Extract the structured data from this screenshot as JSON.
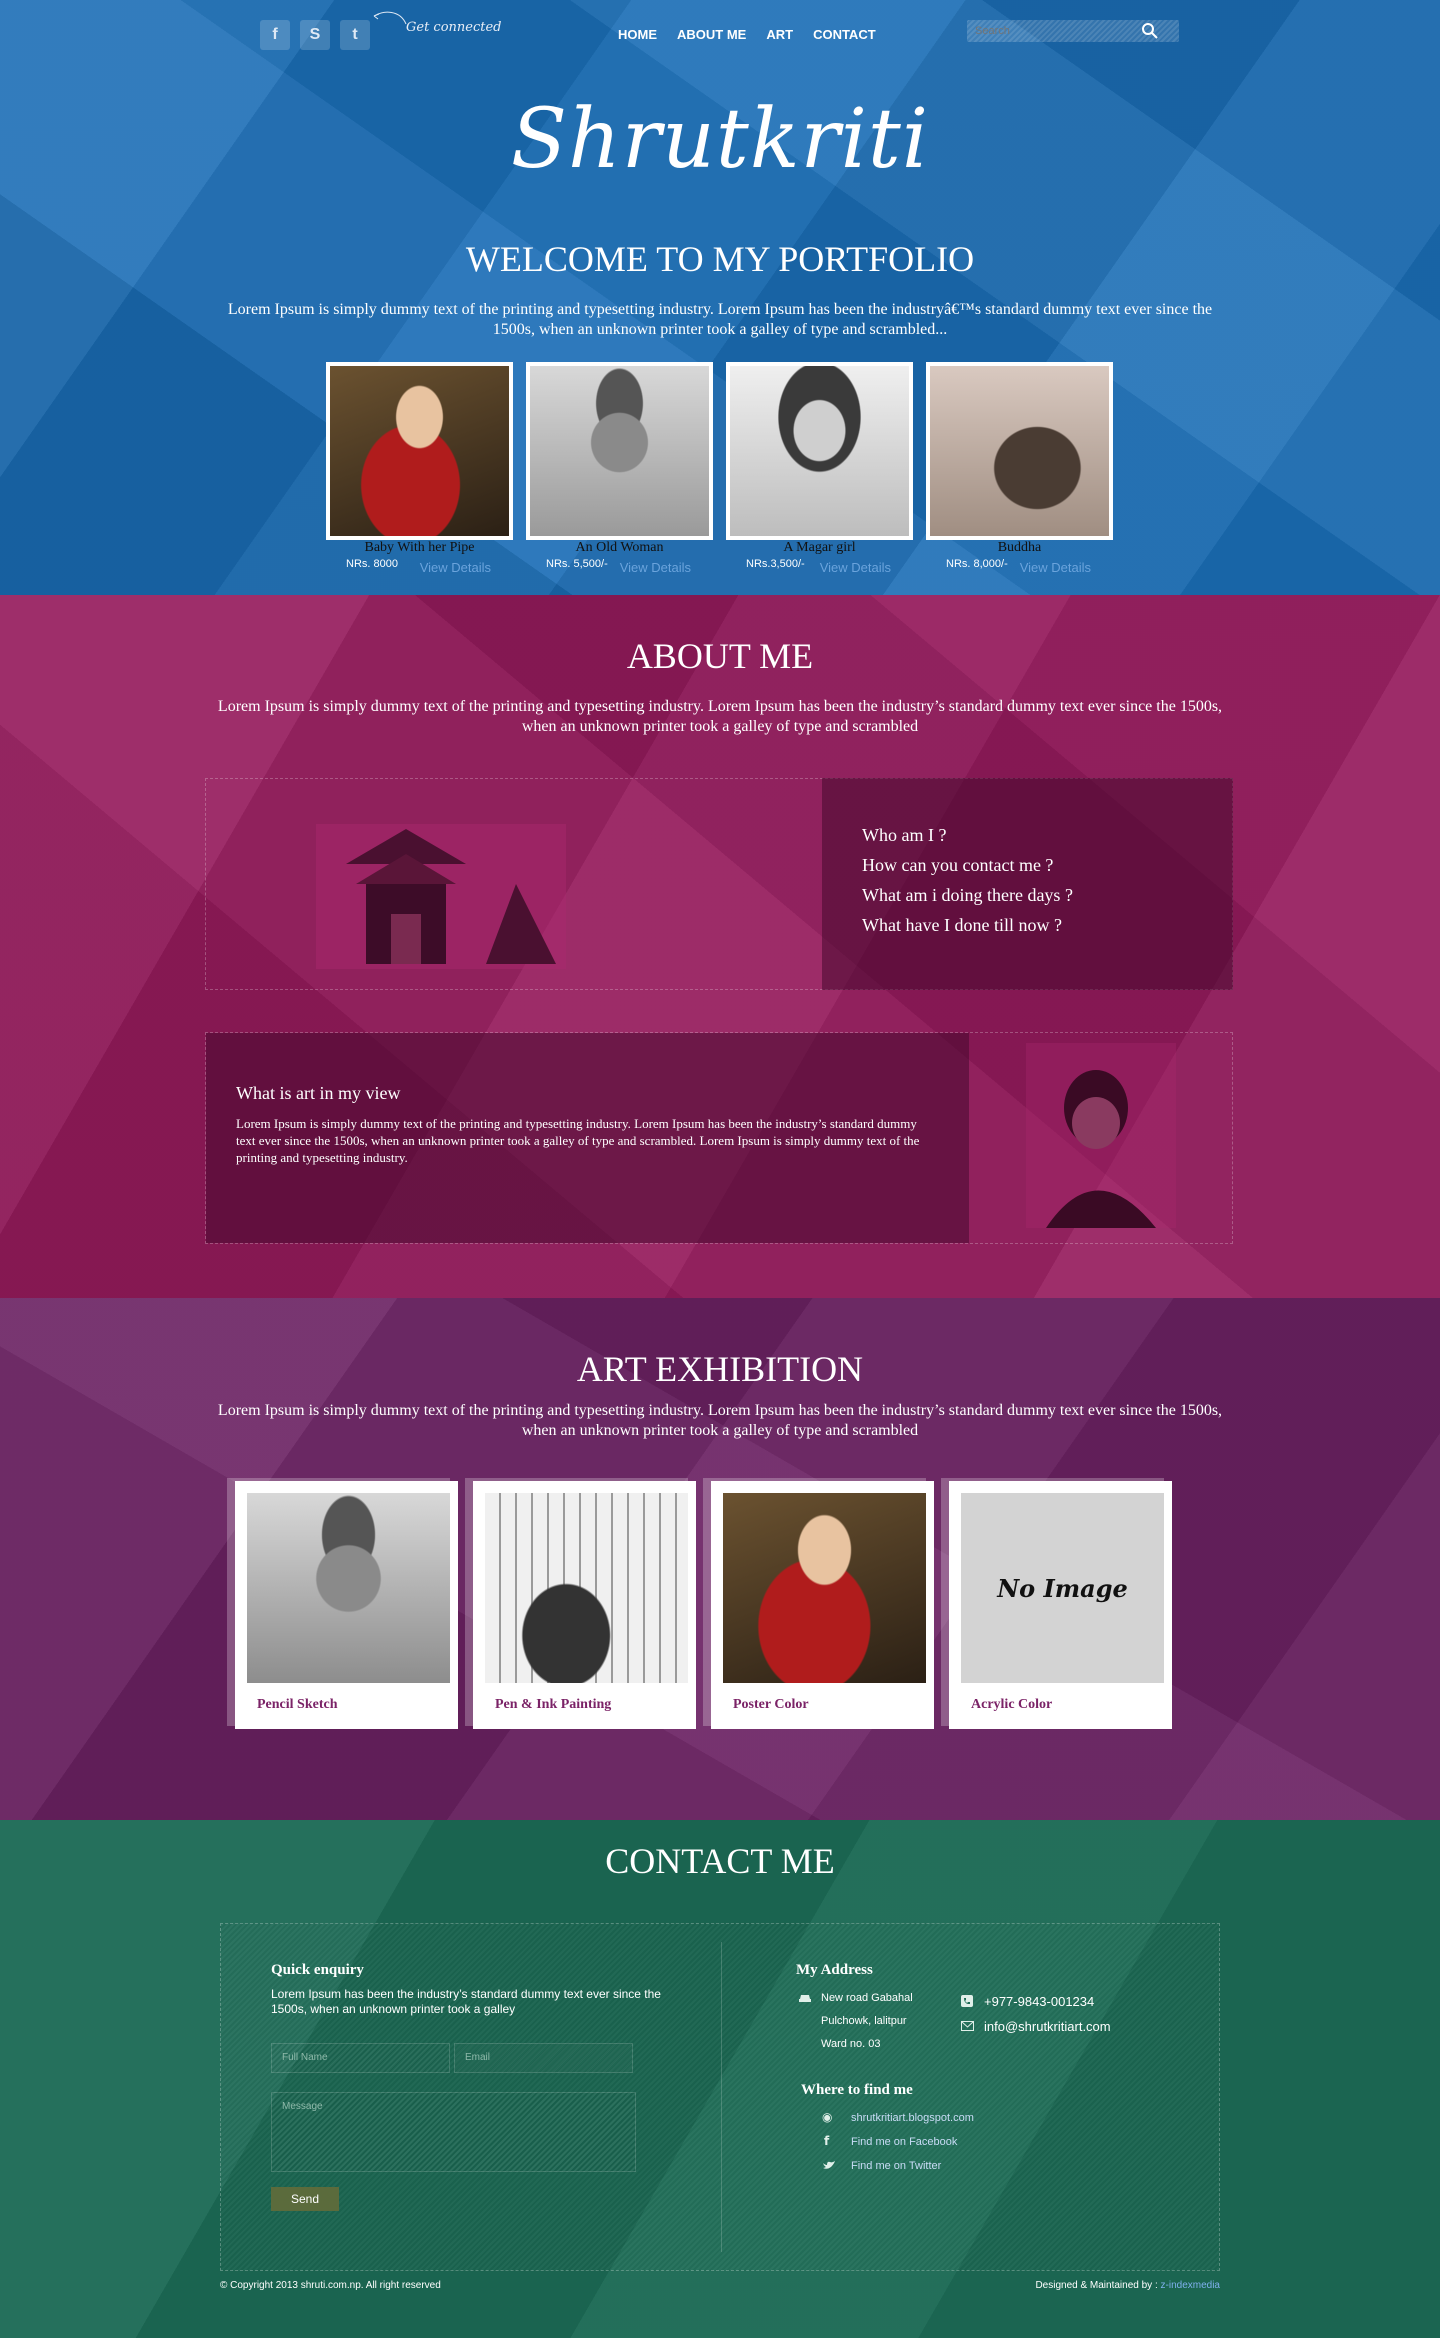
{
  "header": {
    "social": [
      {
        "name": "facebook-icon",
        "glyph": "f"
      },
      {
        "name": "skype-icon",
        "glyph": "S"
      },
      {
        "name": "twitter-icon",
        "glyph": "t"
      }
    ],
    "get_connected": "Get connected",
    "nav": [
      "HOME",
      "ABOUT ME",
      "ART",
      "CONTACT"
    ],
    "search_placeholder": "Search"
  },
  "hero": {
    "logo": "Shrutkriti",
    "welcome": "WELCOME TO MY PORTFOLIO",
    "intro": "Lorem Ipsum is simply dummy text of the printing and typesetting industry. Lorem Ipsum has been the industryâ€™s standard dummy text ever since the 1500s, when an unknown printer took a galley of type and scrambled...",
    "items": [
      {
        "title": "Baby With her Pipe",
        "price": "NRs. 8000",
        "details": "View Details"
      },
      {
        "title": "An Old Woman",
        "price": "NRs. 5,500/-",
        "details": "View Details"
      },
      {
        "title": "A Magar girl",
        "price": "NRs.3,500/-",
        "details": "View Details"
      },
      {
        "title": "Buddha",
        "price": "NRs. 8,000/-",
        "details": "View Details"
      }
    ]
  },
  "about": {
    "title": "ABOUT ME",
    "intro": "Lorem Ipsum is simply dummy text of the printing and typesetting industry. Lorem Ipsum has been the industry’s standard dummy text ever since the 1500s, when an unknown printer took a galley of type and scrambled",
    "questions": [
      "Who am I ?",
      "How can you contact me ?",
      "What am i doing there days ?",
      "What have I done till now ?"
    ],
    "art_view_title": "What is art in my view",
    "art_view_text": "Lorem Ipsum is simply dummy text of the printing and typesetting industry. Lorem Ipsum has been the industry’s standard dummy text ever since the 1500s, when an unknown printer took a galley of type and scrambled. Lorem Ipsum is simply dummy text of the printing and typesetting industry."
  },
  "exhibition": {
    "title": "ART EXHIBITION",
    "intro": "Lorem Ipsum is simply dummy text of the printing and typesetting industry. Lorem Ipsum has been the industry’s standard dummy text ever since the 1500s, when an unknown printer took a galley of type and scrambled",
    "cards": [
      {
        "label": "Pencil Sketch"
      },
      {
        "label": "Pen & Ink Painting"
      },
      {
        "label": "Poster Color"
      },
      {
        "label": "Acrylic Color",
        "no_image": "No Image"
      }
    ]
  },
  "contact": {
    "title": "CONTACT ME",
    "enquiry_title": "Quick enquiry",
    "enquiry_text": "Lorem Ipsum has been the industry’s standard dummy text ever since the 1500s, when an unknown printer took a galley",
    "full_name_placeholder": "Full Name",
    "email_placeholder": "Email",
    "message_placeholder": "Message",
    "send": "Send",
    "address_title": "My Address",
    "address": [
      "New road Gabahal",
      "Pulchowk, lalitpur",
      "Ward no. 03"
    ],
    "phone": "+977-9843-001234",
    "email": "info@shrutkritiart.com",
    "find_title": "Where to find me",
    "links": [
      "shrutkritiart.blogspot.com",
      "Find me on Facebook",
      "Find me on Twitter"
    ],
    "copyright": "© Copyright 2013 shruti.com.np. All right reserved",
    "designed_by": "Designed & Maintained by : ",
    "designer": "z-indexmedia"
  },
  "colors": {
    "hero_bg": "#1a6db5",
    "about_bg": "#951a5c",
    "exhibition_bg": "#6b2263",
    "contact_bg": "#1c6a55",
    "card_label": "#7b2367"
  }
}
